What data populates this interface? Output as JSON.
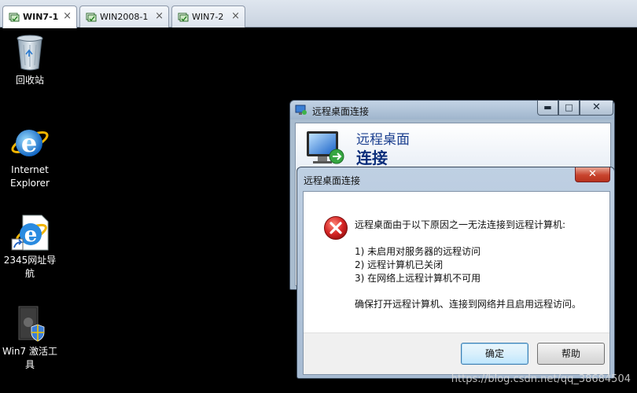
{
  "tabs": [
    {
      "label": "WIN7-1",
      "icon": "vm-icon",
      "active": true,
      "close": "×"
    },
    {
      "label": "WIN2008-1",
      "icon": "vm-icon",
      "active": false,
      "close": "×"
    },
    {
      "label": "WIN7-2",
      "icon": "vm-icon",
      "active": false,
      "close": "×"
    }
  ],
  "desktop": {
    "icons": [
      {
        "label": "回收站",
        "icon": "recycle-bin-icon"
      },
      {
        "label": "Internet Explorer",
        "icon": "internet-explorer-icon"
      },
      {
        "label": "2345网址导航",
        "icon": "ie-shortcut-icon"
      },
      {
        "label": "Win7 激活工具",
        "icon": "activation-tool-icon"
      }
    ]
  },
  "rdc_window": {
    "title": "远程桌面连接",
    "heading_line1": "远程桌面",
    "heading_line2": "连接",
    "controls": {
      "minimize": "▬",
      "maximize": "□",
      "close": "✕"
    }
  },
  "error_dialog": {
    "title": "远程桌面连接",
    "close": "✕",
    "message_intro": "远程桌面由于以下原因之一无法连接到远程计算机:",
    "reasons": [
      "1) 未启用对服务器的远程访问",
      "2) 远程计算机已关闭",
      "3) 在网络上远程计算机不可用"
    ],
    "message_footer": "确保打开远程计算机、连接到网络并且启用远程访问。",
    "ok_label": "确定",
    "help_label": "帮助"
  },
  "watermark": "https://blog.csdn.net/qq_38684504",
  "colors": {
    "desktop_bg": "#000000",
    "error_red": "#c81e1e",
    "heading_blue": "#1b3f8f"
  }
}
